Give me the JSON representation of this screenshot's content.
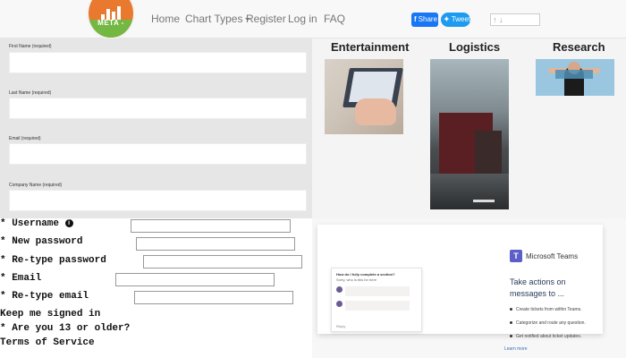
{
  "nav": {
    "logo_text": "META -",
    "links": [
      "Home",
      "Chart Types",
      "Register",
      "Log in",
      "FAQ"
    ],
    "share_facebook": "Share",
    "share_twitter": "Tweet"
  },
  "register_form": {
    "fields": [
      {
        "label": "First Name (required)"
      },
      {
        "label": "Last Name (required)"
      },
      {
        "label": "Email (required)"
      },
      {
        "label": "Company Name (required)"
      }
    ]
  },
  "categories": [
    "Entertainment",
    "Logistics",
    "Research"
  ],
  "signup_form": {
    "fields": [
      {
        "label": "* Username"
      },
      {
        "label": "* New password"
      },
      {
        "label": "* Re-type password"
      },
      {
        "label": "* Email"
      },
      {
        "label": "* Re-type email"
      }
    ],
    "keep_signed_in": "Keep me signed in",
    "age_check": "* Are you 13 or older?",
    "terms": "Terms of Service"
  },
  "teams_ad": {
    "brand": "Microsoft Teams",
    "headline": "Take actions on messages to ...",
    "bullets": [
      "Create tickets from within Teams.",
      "Categorize and route any question.",
      "Get notified about ticket updates."
    ],
    "learn_more": "Learn more",
    "chat_question": "How do I fully complete a section?",
    "chat_sub": "Sorry, who is this for here",
    "chat_footer": "Reply",
    "accent_color": "#5b5fc7"
  }
}
